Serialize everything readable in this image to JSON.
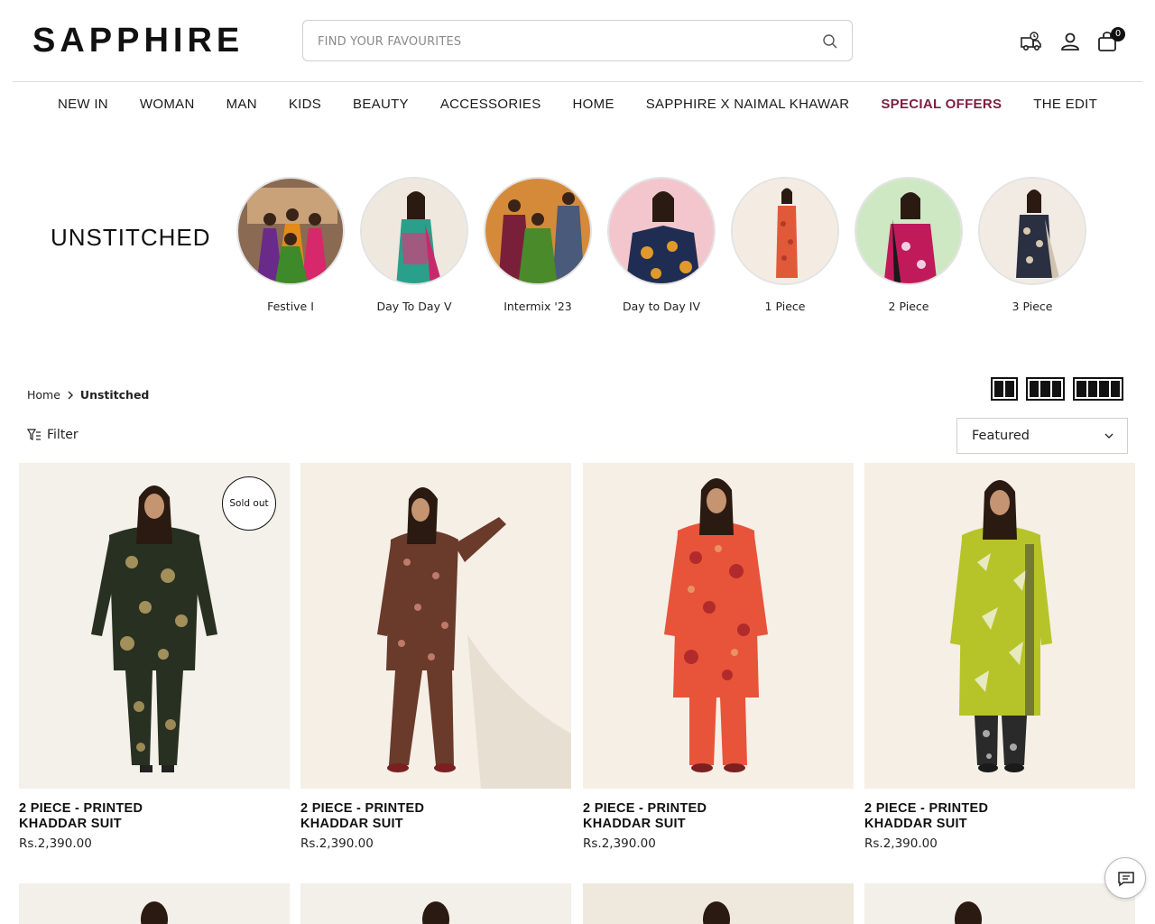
{
  "brand": {
    "logo": "SAPPHIRE"
  },
  "search": {
    "placeholder": "FIND YOUR FAVOURITES"
  },
  "header": {
    "icons": [
      "delivery-truck-icon",
      "user-icon",
      "shopping-bag-icon"
    ],
    "cart_count": "0"
  },
  "nav": {
    "items": [
      {
        "label": "NEW IN"
      },
      {
        "label": "WOMAN"
      },
      {
        "label": "MAN"
      },
      {
        "label": "KIDS"
      },
      {
        "label": "BEAUTY"
      },
      {
        "label": "ACCESSORIES"
      },
      {
        "label": "HOME"
      },
      {
        "label": "SAPPHIRE X NAIMAL KHAWAR"
      },
      {
        "label": "SPECIAL OFFERS",
        "highlight_color": "#7d1f3e"
      },
      {
        "label": "THE EDIT"
      }
    ]
  },
  "collection": {
    "title": "UNSTITCHED",
    "categories": [
      {
        "label": "Festive I"
      },
      {
        "label": "Day To Day V"
      },
      {
        "label": "Intermix '23"
      },
      {
        "label": "Day to Day IV"
      },
      {
        "label": "1 Piece"
      },
      {
        "label": "2 Piece"
      },
      {
        "label": "3 Piece"
      }
    ]
  },
  "breadcrumb": {
    "home": "Home",
    "current": "Unstitched"
  },
  "toolbar": {
    "filter_label": "Filter",
    "sort_selected": "Featured"
  },
  "products": [
    {
      "title": "2 PIECE - PRINTED KHADDAR SUIT",
      "price": "Rs.2,390.00",
      "badge": "Sold out"
    },
    {
      "title": "2 PIECE - PRINTED KHADDAR SUIT",
      "price": "Rs.2,390.00"
    },
    {
      "title": "2 PIECE - PRINTED KHADDAR SUIT",
      "price": "Rs.2,390.00"
    },
    {
      "title": "2 PIECE - PRINTED KHADDAR SUIT",
      "price": "Rs.2,390.00"
    }
  ],
  "colors": {
    "accent": "#7d1f3e",
    "text": "#111111",
    "image_bg": "#f3efe9"
  }
}
